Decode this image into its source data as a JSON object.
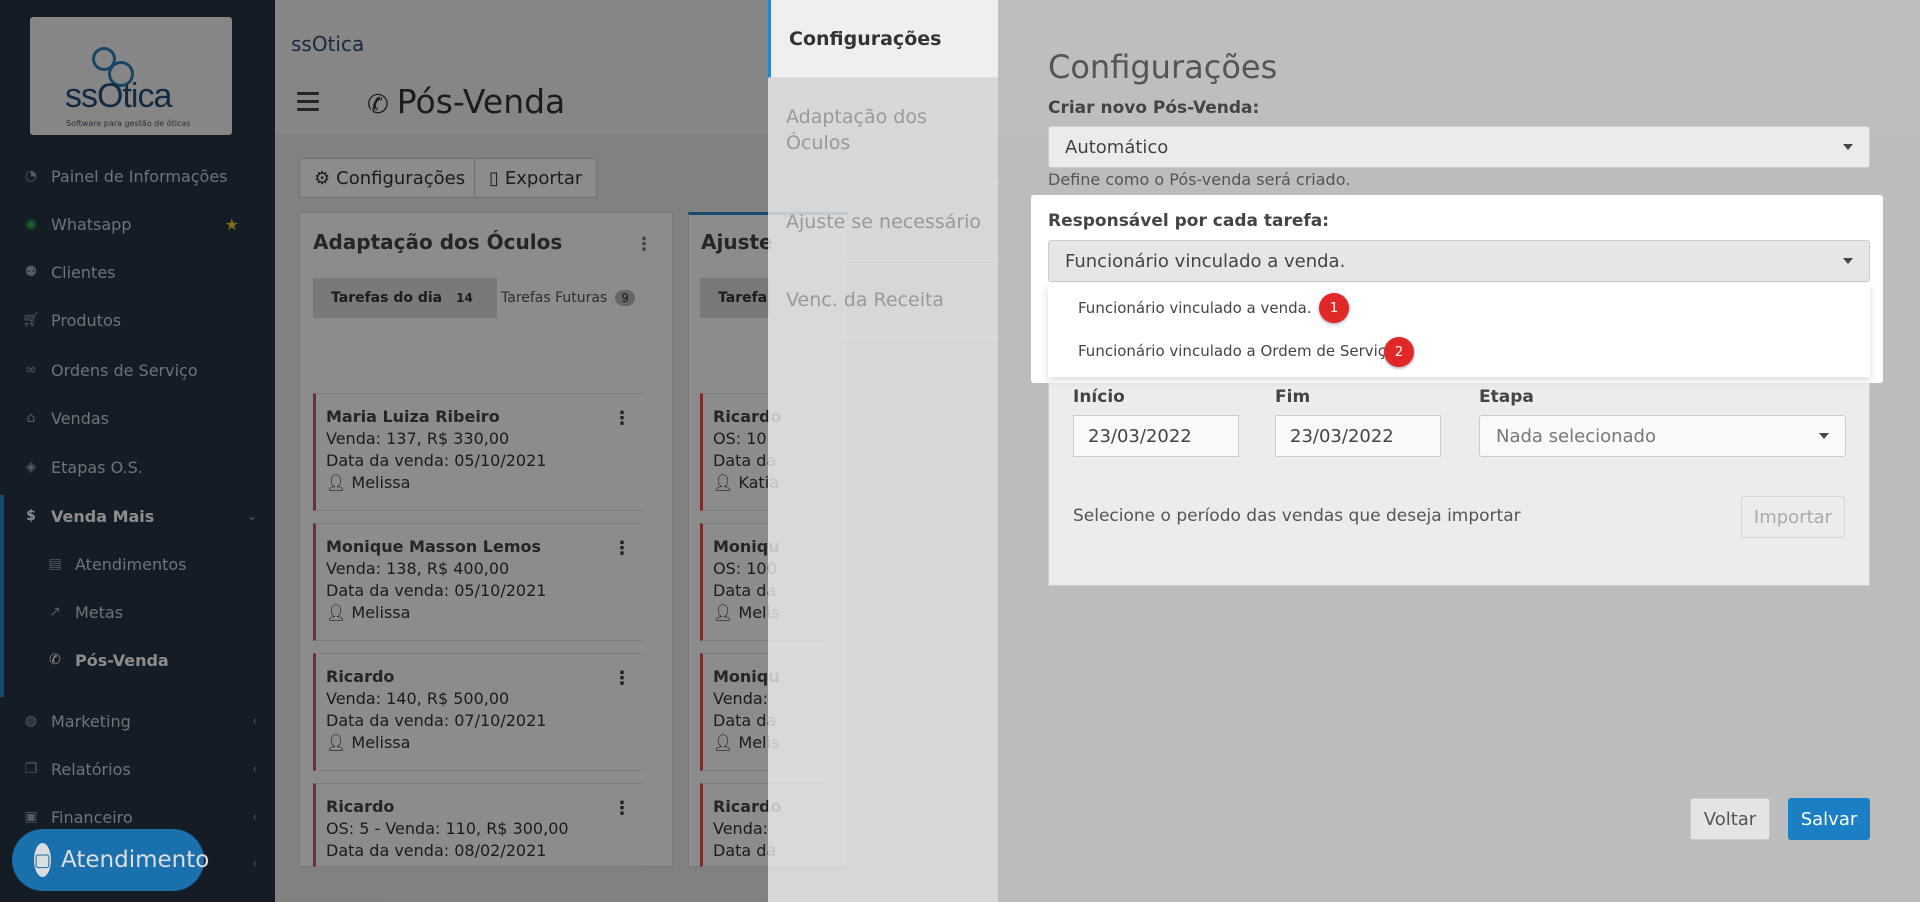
{
  "sidebar": {
    "logo_text": "ssOtica",
    "logo_sub": "Software para gestão de óticas",
    "items": [
      {
        "label": "Painel de Informações",
        "icon": "dashboard-icon"
      },
      {
        "label": "Whatsapp",
        "icon": "whatsapp-icon"
      },
      {
        "label": "Clientes",
        "icon": "users-icon"
      },
      {
        "label": "Produtos",
        "icon": "cart-icon"
      },
      {
        "label": "Ordens de Serviço",
        "icon": "glasses-icon"
      },
      {
        "label": "Vendas",
        "icon": "basket-icon"
      },
      {
        "label": "Etapas O.S.",
        "icon": "tag-icon"
      },
      {
        "label": "Venda Mais",
        "icon": "dollar-icon"
      },
      {
        "label": "Atendimentos",
        "icon": "clipboard-icon"
      },
      {
        "label": "Metas",
        "icon": "chart-icon"
      },
      {
        "label": "Pós-Venda",
        "icon": "phone-icon"
      },
      {
        "label": "Marketing",
        "icon": "comments-icon"
      },
      {
        "label": "Relatórios",
        "icon": "copy-icon"
      },
      {
        "label": "Financeiro",
        "icon": "money-icon"
      }
    ],
    "atendimento_label": "Atendimento"
  },
  "header": {
    "brand": "ssOtica",
    "page_title": "Pós-Venda",
    "btn_config": "Configurações",
    "btn_export": "Exportar"
  },
  "columns": [
    {
      "title": "Adaptação dos Óculos",
      "tab_today": "Tarefas do dia",
      "tab_today_count": "14",
      "tab_future": "Tarefas Futuras",
      "tab_future_count": "9",
      "tasks": [
        {
          "name": "Maria Luiza Ribeiro",
          "line1": "Venda: 137, R$ 330,00",
          "line2": "Data da venda: 05/10/2021",
          "user": "Melissa"
        },
        {
          "name": "Monique Masson Lemos",
          "line1": "Venda: 138, R$ 400,00",
          "line2": "Data da venda: 05/10/2021",
          "user": "Melissa"
        },
        {
          "name": "Ricardo",
          "line1": "Venda: 140, R$ 500,00",
          "line2": "Data da venda: 07/10/2021",
          "user": "Melissa"
        },
        {
          "name": "Ricardo",
          "line1": "OS: 5 - Venda: 110, R$ 300,00",
          "line2": "Data da venda: 08/02/2021",
          "user": ""
        }
      ]
    },
    {
      "title": "Ajuste",
      "tab_today": "Tarefa",
      "tasks": [
        {
          "name": "Ricardo",
          "line1": "OS: 10",
          "line2": "Data da",
          "user": "Katia"
        },
        {
          "name": "Moniqu",
          "line1": "OS: 100",
          "line2": "Data da",
          "user": "Melis"
        },
        {
          "name": "Moniqu",
          "line1": "Venda:",
          "line2": "Data da",
          "user": "Melis"
        },
        {
          "name": "Ricardo",
          "line1": "Venda:",
          "line2": "Data da",
          "user": ""
        }
      ]
    }
  ],
  "settings": {
    "tabs": [
      "Configurações",
      "Adaptação dos Óculos",
      "Ajuste se necessário",
      "Venc. da Receita"
    ],
    "title": "Configurações",
    "criar_label": "Criar novo Pós-Venda:",
    "criar_value": "Automático",
    "criar_help": "Define como o Pós-venda será criado.",
    "resp_label": "Responsável por cada tarefa:",
    "resp_value": "Funcionário vinculado a venda.",
    "options": [
      "Funcionário vinculado a venda.",
      "Funcionário vinculado a Ordem de Serviço."
    ],
    "markers": [
      "1",
      "2"
    ],
    "inicio_label": "Início",
    "inicio_value": "23/03/2022",
    "fim_label": "Fim",
    "fim_value": "23/03/2022",
    "etapa_label": "Etapa",
    "etapa_value": "Nada selecionado",
    "import_help": "Selecione o período das vendas que deseja importar",
    "import_btn": "Importar",
    "voltar": "Voltar",
    "salvar": "Salvar"
  },
  "colors": {
    "accent": "#1a7fc4",
    "marker": "#e02828",
    "sidebar": "#253345"
  }
}
